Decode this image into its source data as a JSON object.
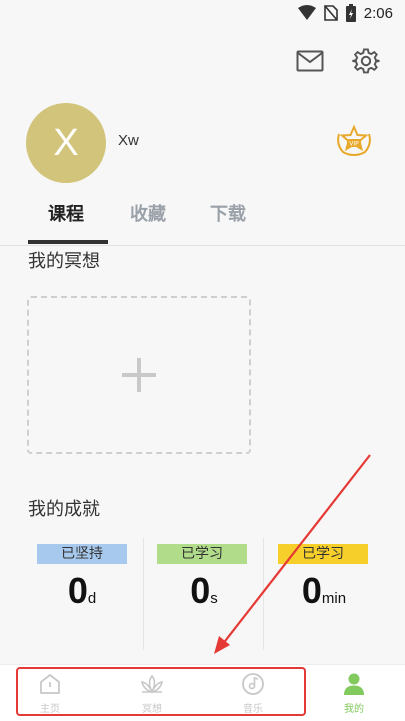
{
  "status_bar": {
    "time": "2:06"
  },
  "profile": {
    "avatar_initial": "X",
    "username": "Xw"
  },
  "tabs": [
    {
      "label": "课程",
      "active": true
    },
    {
      "label": "收藏",
      "active": false
    },
    {
      "label": "下载",
      "active": false
    }
  ],
  "meditation": {
    "title": "我的冥想"
  },
  "achievements": {
    "title": "我的成就",
    "stats": [
      {
        "label": "已坚持",
        "value": "0",
        "unit": "d",
        "color": "#a8c9ee"
      },
      {
        "label": "已学习",
        "value": "0",
        "unit": "s",
        "color": "#b1dc8a"
      },
      {
        "label": "已学习",
        "value": "0",
        "unit": "min",
        "color": "#f7cf2a"
      }
    ]
  },
  "bottom_nav": [
    {
      "label": "主页",
      "icon": "home-icon",
      "active": false
    },
    {
      "label": "冥想",
      "icon": "lotus-icon",
      "active": false
    },
    {
      "label": "音乐",
      "icon": "music-disc-icon",
      "active": false
    },
    {
      "label": "我的",
      "icon": "person-icon",
      "active": true
    }
  ],
  "colors": {
    "accent_green": "#82c95e",
    "vip_gold": "#e8a92a",
    "avatar_bg": "#d2c47b",
    "annotation_red": "#e53935"
  }
}
